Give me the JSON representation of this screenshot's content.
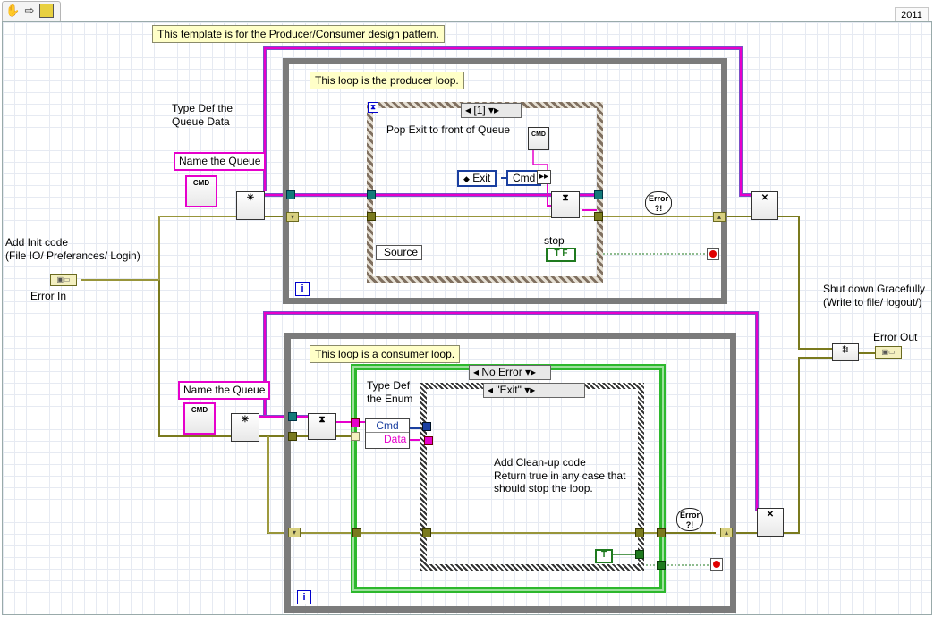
{
  "toolbar": {
    "icons": [
      "hand-tool-icon",
      "step-arrow-icon",
      "highlight-execution-icon"
    ],
    "version": "2011"
  },
  "notes": {
    "template": "This template is for the Producer/Consumer design pattern.",
    "producer": "This loop is the producer loop.",
    "consumer": "This loop is a consumer loop."
  },
  "labels": {
    "typedef_queue": "Type Def the\nQueue Data",
    "name_queue_1": "Name the Queue",
    "name_queue_2": "Name the Queue",
    "add_init": "Add Init code\n(File IO/ Preferances/ Login)",
    "error_in": "Error In",
    "shutdown": "Shut down Gracefully\n(Write to file/ logout/)",
    "error_out": "Error Out",
    "pop_exit": "Pop Exit to front of Queue",
    "stop": "stop",
    "source": "Source",
    "typedef_enum": "Type Def\nthe Enum",
    "cleanup": "Add Clean-up code\nReturn true in any case that\nshould stop the loop."
  },
  "producer_case": {
    "selector": "[1]"
  },
  "consumer_case": {
    "selector": "No Error",
    "inner_selector": "\"Exit\""
  },
  "constants": {
    "exit_enum": "Exit",
    "cmd": "Cmd",
    "cmd2": "Cmd",
    "data": "Data",
    "tf": "T F",
    "true_const": "T",
    "iteration": "i",
    "cmd_icon": "CMD"
  },
  "colors": {
    "error_wire": "#7a7a1e",
    "queue_wire": "#e600cc",
    "queue_wire_border": "#7b4fc7",
    "boolean_wire": "#1f7a1f",
    "enum_wire": "#1a3fa0",
    "loop_border": "#7b7b7b",
    "case_border_green": "#2db82d",
    "note_bg": "#ffffc8"
  }
}
